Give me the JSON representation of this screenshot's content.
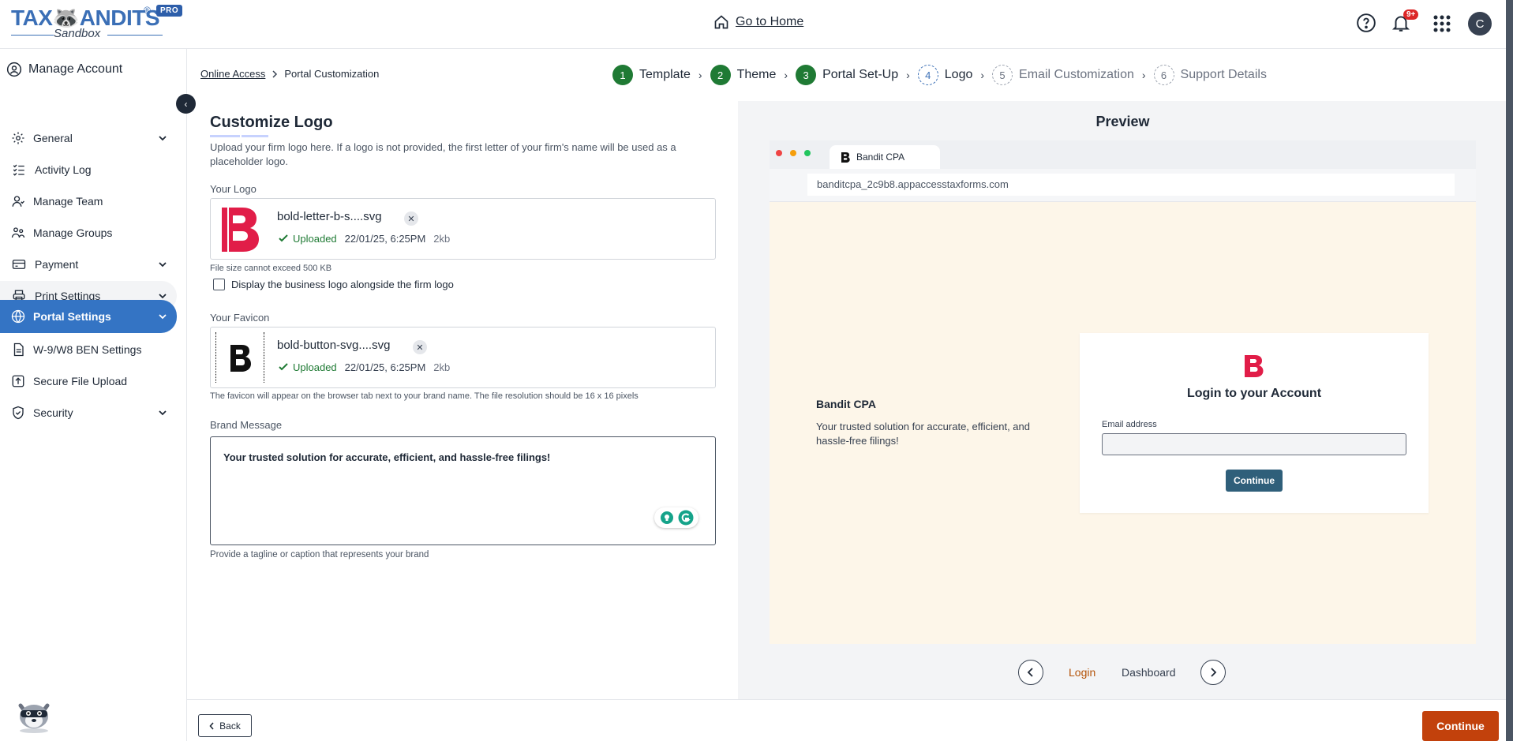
{
  "header": {
    "logo_text_a": "TAX",
    "logo_text_b": "ANDITS",
    "logo_reg": "®",
    "logo_badge": "PRO",
    "logo_sub": "Sandbox",
    "go_home": "Go to Home",
    "notification_badge": "9+",
    "avatar_initial": "C"
  },
  "sidebar": {
    "title": "Manage Account",
    "items": [
      {
        "label": "General",
        "icon": "gear-icon",
        "has_chevron": true
      },
      {
        "label": "Activity Log",
        "icon": "list-icon",
        "has_chevron": false
      },
      {
        "label": "Manage Team",
        "icon": "user-icon",
        "has_chevron": false
      },
      {
        "label": "Manage Groups",
        "icon": "users-icon",
        "has_chevron": false
      },
      {
        "label": "Payment",
        "icon": "card-icon",
        "has_chevron": true
      },
      {
        "label": "Print Settings",
        "icon": "printer-icon",
        "has_chevron": true
      },
      {
        "label": "Portal Settings",
        "icon": "globe-icon",
        "has_chevron": true,
        "active": true
      },
      {
        "label": "W-9/W8 BEN Settings",
        "icon": "document-icon",
        "has_chevron": false
      },
      {
        "label": "Secure File Upload",
        "icon": "upload-icon",
        "has_chevron": false
      },
      {
        "label": "Security",
        "icon": "shield-icon",
        "has_chevron": true
      }
    ]
  },
  "breadcrumb": {
    "link": "Online Access",
    "current": "Portal Customization"
  },
  "stepper": [
    {
      "num": "1",
      "label": "Template",
      "state": "done"
    },
    {
      "num": "2",
      "label": "Theme",
      "state": "done"
    },
    {
      "num": "3",
      "label": "Portal Set-Up",
      "state": "done"
    },
    {
      "num": "4",
      "label": "Logo",
      "state": "current"
    },
    {
      "num": "5",
      "label": "Email Customization",
      "state": "todo"
    },
    {
      "num": "6",
      "label": "Support Details",
      "state": "todo"
    }
  ],
  "form": {
    "title": "Customize Logo",
    "intro": "Upload your firm logo here. If a logo is not provided, the first letter of your firm's name will be used as a placeholder logo.",
    "logo_label": "Your Logo",
    "logo_file": "bold-letter-b-s....svg",
    "logo_status": "Uploaded",
    "logo_date": "22/01/25, 6:25PM",
    "logo_size": "2kb",
    "logo_note": "File size cannot exceed 500 KB",
    "display_checkbox": "Display the business logo alongside the firm logo",
    "favicon_label": "Your Favicon",
    "favicon_file": "bold-button-svg....svg",
    "favicon_status": "Uploaded",
    "favicon_date": "22/01/25, 6:25PM",
    "favicon_size": "2kb",
    "favicon_note": "The favicon will appear on the browser tab next to your brand name. The file resolution should be 16 x 16 pixels",
    "brand_label": "Brand Message",
    "brand_value": "Your trusted solution for accurate, efficient, and hassle-free filings!",
    "brand_note": "Provide a tagline or caption that represents your brand"
  },
  "preview": {
    "title": "Preview",
    "tab_title": "Bandit CPA",
    "address": "banditcpa_2c9b8.appaccesstaxforms.com",
    "brand_name": "Bandit CPA",
    "brand_tagline": "Your trusted solution for accurate, efficient, and hassle-free filings!",
    "card_title": "Login to your Account",
    "email_label": "Email address",
    "card_button": "Continue",
    "nav_login": "Login",
    "nav_dashboard": "Dashboard"
  },
  "footer": {
    "back": "Back",
    "continue": "Continue"
  },
  "colors": {
    "brand_red": "#e11d48",
    "active_nav": "#3474c4",
    "done_step": "#1f7a34",
    "continue": "#c2410c",
    "preview_bg": "#fdf6e9"
  }
}
